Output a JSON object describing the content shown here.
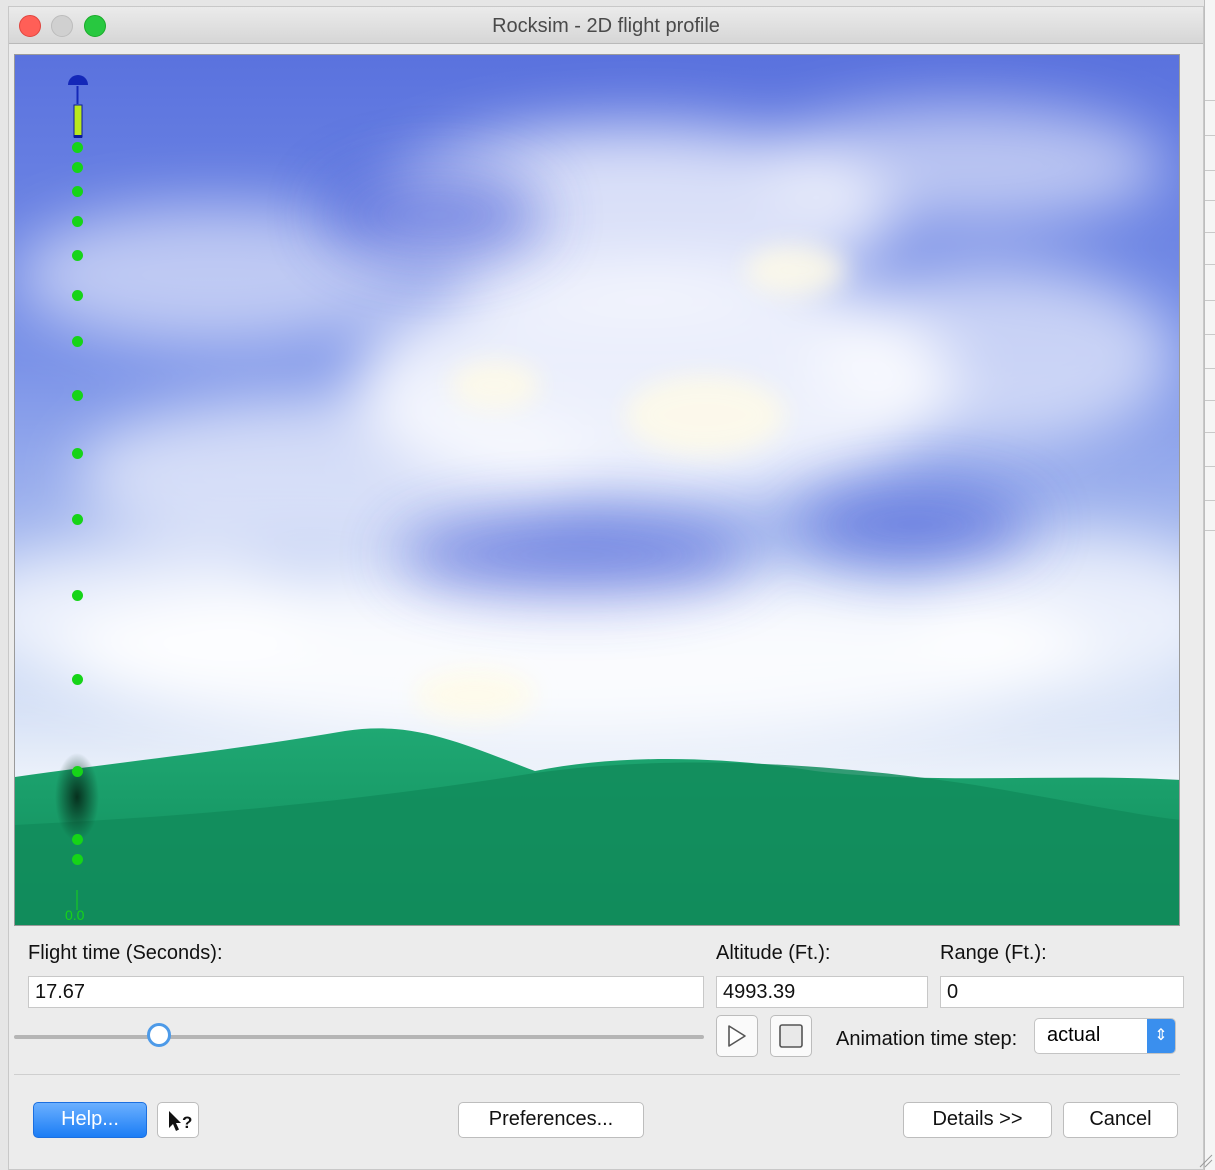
{
  "window": {
    "title": "Rocksim - 2D flight profile"
  },
  "scene": {
    "ground_label": "0.0"
  },
  "fields": {
    "flight_time_label": "Flight time (Seconds):",
    "flight_time_value": "17.67",
    "altitude_label": "Altitude (Ft.):",
    "altitude_value": "4993.39",
    "range_label": "Range (Ft.):",
    "range_value": "0"
  },
  "animation": {
    "slider_position": 0.21,
    "time_step_label": "Animation time step:",
    "time_step_value": "actual"
  },
  "buttons": {
    "help": "Help...",
    "preferences": "Preferences...",
    "details": "Details >>",
    "cancel": "Cancel"
  },
  "colors": {
    "trajectory_dot": "#16d418",
    "accent": "#1b7df5",
    "close_light": "#ff5f57",
    "zoom_light": "#28c840"
  },
  "icons": {
    "play": "play-icon",
    "stop": "stop-icon",
    "context_help": "context-help-icon"
  }
}
